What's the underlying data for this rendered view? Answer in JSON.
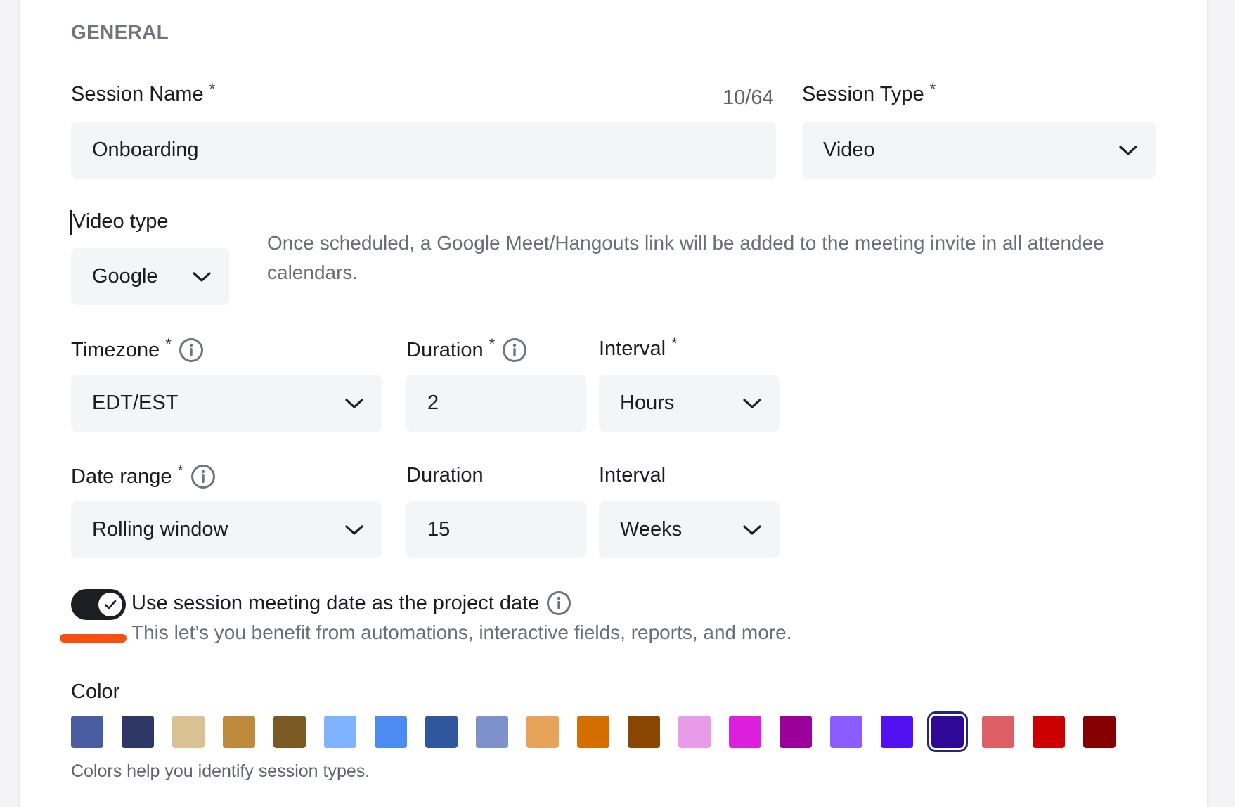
{
  "section": {
    "title": "GENERAL"
  },
  "session_name": {
    "label": "Session Name",
    "required": "*",
    "counter": "10/64",
    "value": "Onboarding"
  },
  "session_type": {
    "label": "Session Type",
    "required": "*",
    "value": "Video"
  },
  "video_type": {
    "label": "Video type",
    "value": "Google",
    "help": "Once scheduled, a Google Meet/Hangouts link will be added to the meeting invite in all attendee calendars."
  },
  "timezone": {
    "label": "Timezone",
    "required": "*",
    "value": "EDT/EST"
  },
  "duration": {
    "label": "Duration",
    "required": "*",
    "value": "2"
  },
  "interval": {
    "label": "Interval",
    "required": "*",
    "value": "Hours"
  },
  "date_range": {
    "label": "Date range",
    "required": "*",
    "value": "Rolling window"
  },
  "range_duration": {
    "label": "Duration",
    "value": "15"
  },
  "range_interval": {
    "label": "Interval",
    "value": "Weeks"
  },
  "project_date_toggle": {
    "on": true,
    "label": "Use session meeting date as the project date",
    "description": "This let’s you benefit from automations, interactive fields, reports, and more."
  },
  "color": {
    "label": "Color",
    "help": "Colors help you identify session types.",
    "selected_index": 17,
    "swatches": [
      "#4a5da3",
      "#2e3766",
      "#d9c193",
      "#be8a3c",
      "#7a5a22",
      "#80b3ff",
      "#4e8bf0",
      "#2f579e",
      "#7f91cb",
      "#e6a45a",
      "#d46e00",
      "#8a4700",
      "#e89be8",
      "#dc1fdc",
      "#9b009b",
      "#8b5cff",
      "#5310f0",
      "#2e0897",
      "#df5f66",
      "#cc0000",
      "#850000"
    ]
  },
  "accent": {
    "orange": "#fb4f0f",
    "toggle": "#1c1e23"
  }
}
